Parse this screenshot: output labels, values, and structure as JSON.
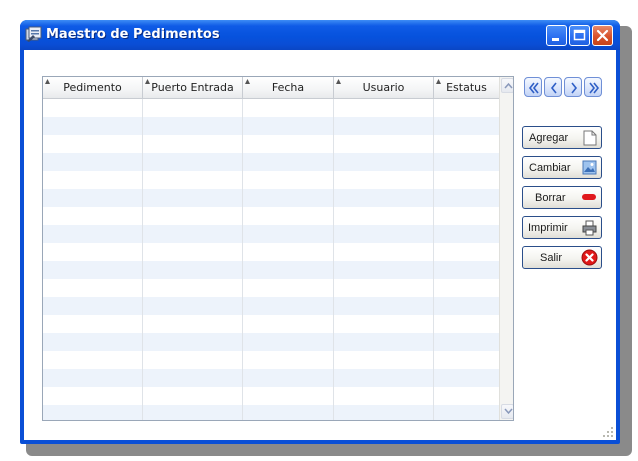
{
  "window": {
    "title": "Maestro de Pedimentos",
    "controls": [
      "minimize-icon",
      "maximize-icon",
      "close-icon"
    ]
  },
  "grid": {
    "columns": [
      "Pedimento",
      "Puerto Entrada",
      "Fecha",
      "Usuario",
      "Estatus"
    ],
    "row_count": 18
  },
  "navigation": [
    "first-record-icon",
    "previous-record-icon",
    "next-record-icon",
    "last-record-icon"
  ],
  "actions": {
    "add": {
      "label": "Agregar",
      "icon": "new-document-icon"
    },
    "change": {
      "label": "Cambiar",
      "icon": "edit-picture-icon"
    },
    "delete": {
      "label": "Borrar",
      "icon": "red-dash-icon"
    },
    "print": {
      "label": "Imprimir",
      "icon": "printer-icon"
    },
    "exit": {
      "label": "Salir",
      "icon": "red-x-icon"
    }
  },
  "colors": {
    "titlebar": "#0a4fd6",
    "row_alt": "#edf3fb",
    "close_button": "#d8522c"
  }
}
